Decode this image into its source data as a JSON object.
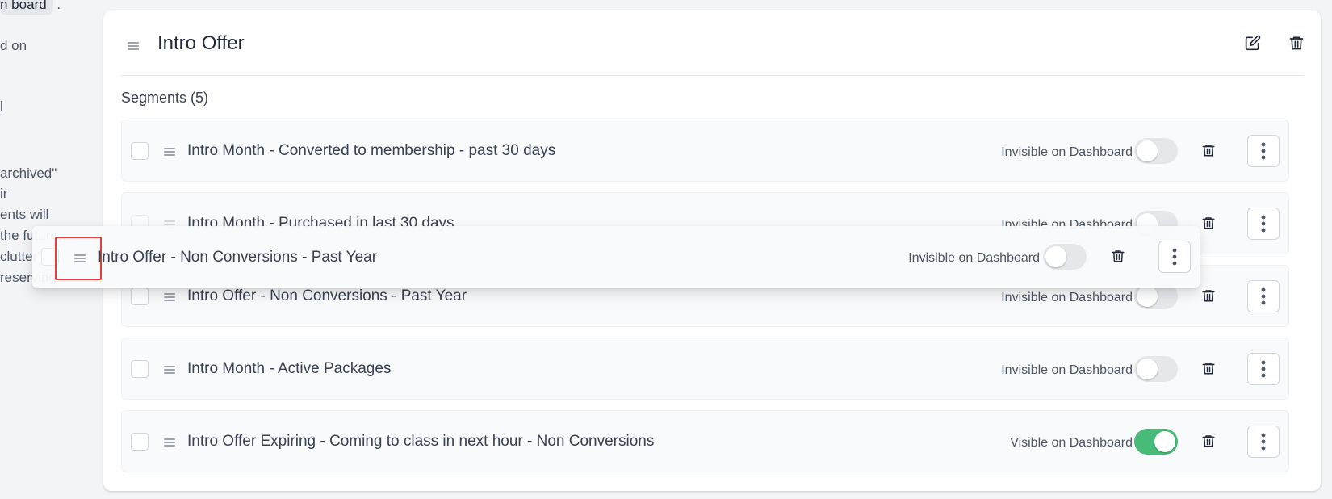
{
  "left_text": {
    "lines": [
      "n board",
      ".",
      "d on",
      "l",
      "archived\"",
      "ir",
      "ents will",
      "the future,",
      "clutter\"",
      "reserving"
    ]
  },
  "card": {
    "title": "Intro Offer",
    "edit_label": "edit-icon",
    "delete_label": "trash-icon",
    "segments_heading": "Segments (5)"
  },
  "segments": [
    {
      "name": "Intro Month - Converted to membership - past 30 days",
      "visibility": "Invisible on Dashboard",
      "visible": false
    },
    {
      "name": "Intro Month - Purchased in last 30 days",
      "visibility": "Invisible on Dashboard",
      "visible": false
    },
    {
      "name": "Intro Offer - Non Conversions - Past Year",
      "visibility": "Invisible on Dashboard",
      "visible": false
    },
    {
      "name": "Intro Month - Active Packages",
      "visibility": "Invisible on Dashboard",
      "visible": false
    },
    {
      "name": "Intro Offer Expiring - Coming to class in next hour - Non Conversions",
      "visibility": "Visible on Dashboard",
      "visible": true
    }
  ],
  "dragging": {
    "name": "Intro Offer - Non Conversions - Past Year",
    "visibility": "Invisible on Dashboard",
    "visible": false
  },
  "colors": {
    "toggle_on": "#48bb78",
    "toggle_off": "#e5e7eb",
    "focus_outline": "#e53e3e"
  }
}
